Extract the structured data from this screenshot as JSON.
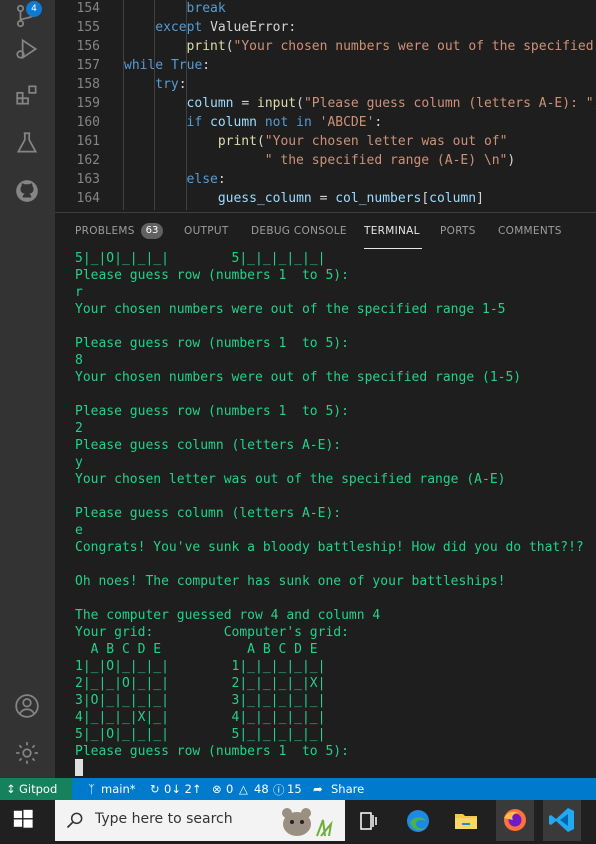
{
  "activity_bar": {
    "source_control_badge": "4"
  },
  "editor": {
    "lines": [
      {
        "num": "154",
        "indent": 12,
        "parts": [
          {
            "t": "break",
            "c": "kw"
          }
        ]
      },
      {
        "num": "155",
        "indent": 8,
        "parts": [
          {
            "t": "except ",
            "c": "kw"
          },
          {
            "t": "ValueError",
            "c": "plain"
          },
          {
            "t": ":",
            "c": "plain"
          }
        ]
      },
      {
        "num": "156",
        "indent": 12,
        "parts": [
          {
            "t": "print",
            "c": "fn"
          },
          {
            "t": "(",
            "c": "plain"
          },
          {
            "t": "\"Your chosen numbers were out of the specified range\")",
            "c": "str"
          }
        ]
      },
      {
        "num": "157",
        "indent": 4,
        "parts": [
          {
            "t": "while ",
            "c": "kw"
          },
          {
            "t": "True",
            "c": "kw"
          },
          {
            "t": ":",
            "c": "plain"
          }
        ]
      },
      {
        "num": "158",
        "indent": 8,
        "parts": [
          {
            "t": "try",
            "c": "kw"
          },
          {
            "t": ":",
            "c": "plain"
          }
        ]
      },
      {
        "num": "159",
        "indent": 12,
        "parts": [
          {
            "t": "column",
            "c": "var"
          },
          {
            "t": " = ",
            "c": "plain"
          },
          {
            "t": "input",
            "c": "fn"
          },
          {
            "t": "(",
            "c": "plain"
          },
          {
            "t": "\"Please guess column (letters A-E): \")",
            "c": "str"
          }
        ]
      },
      {
        "num": "160",
        "indent": 12,
        "parts": [
          {
            "t": "if ",
            "c": "kw"
          },
          {
            "t": "column",
            "c": "var"
          },
          {
            "t": " not in ",
            "c": "kw"
          },
          {
            "t": "'ABCDE'",
            "c": "str"
          },
          {
            "t": ":",
            "c": "plain"
          }
        ]
      },
      {
        "num": "161",
        "indent": 16,
        "parts": [
          {
            "t": "print",
            "c": "fn"
          },
          {
            "t": "(",
            "c": "plain"
          },
          {
            "t": "\"Your chosen letter was out of\"",
            "c": "str"
          }
        ]
      },
      {
        "num": "162",
        "indent": 22,
        "parts": [
          {
            "t": "\" the specified range (A-E) \\n\"",
            "c": "str"
          },
          {
            "t": ")",
            "c": "plain"
          }
        ]
      },
      {
        "num": "163",
        "indent": 12,
        "parts": [
          {
            "t": "else",
            "c": "kw"
          },
          {
            "t": ":",
            "c": "plain"
          }
        ]
      },
      {
        "num": "164",
        "indent": 16,
        "parts": [
          {
            "t": "guess_column",
            "c": "var"
          },
          {
            "t": " = ",
            "c": "plain"
          },
          {
            "t": "col_numbers",
            "c": "var"
          },
          {
            "t": "[",
            "c": "plain"
          },
          {
            "t": "column",
            "c": "var"
          },
          {
            "t": "]",
            "c": "plain"
          }
        ]
      }
    ]
  },
  "panel": {
    "tabs": [
      {
        "label": "PROBLEMS",
        "active": false
      },
      {
        "label": "OUTPUT",
        "active": false
      },
      {
        "label": "DEBUG CONSOLE",
        "active": false
      },
      {
        "label": "TERMINAL",
        "active": true
      },
      {
        "label": "PORTS",
        "active": false
      },
      {
        "label": "COMMENTS",
        "active": false
      }
    ],
    "problems_count": "63"
  },
  "terminal": {
    "lines": [
      "5|_|O|_|_|_|        5|_|_|_|_|_|",
      "Please guess row (numbers 1  to 5):",
      "r",
      "Your chosen numbers were out of the specified range 1-5",
      "",
      "Please guess row (numbers 1  to 5):",
      "8",
      "Your chosen numbers were out of the specified range (1-5)",
      "",
      "Please guess row (numbers 1  to 5):",
      "2",
      "Please guess column (letters A-E):",
      "y",
      "Your chosen letter was out of the specified range (A-E)",
      "",
      "Please guess column (letters A-E):",
      "e",
      "Congrats! You've sunk a bloody battleship! How did you do that?!?",
      "",
      "Oh noes! The computer has sunk one of your battleships!",
      "",
      "The computer guessed row 4 and column 4",
      "Your grid:         Computer's grid:",
      "  A B C D E           A B C D E",
      "1|_|O|_|_|_|        1|_|_|_|_|_|",
      "2|_|_|O|_|_|        2|_|_|_|_|X|",
      "3|O|_|_|_|_|        3|_|_|_|_|_|",
      "4|_|_|_|X|_|        4|_|_|_|_|_|",
      "5|_|O|_|_|_|        5|_|_|_|_|_|",
      "Please guess row (numbers 1  to 5):"
    ]
  },
  "statusbar": {
    "remote": "Gitpod",
    "branch": "main*",
    "sync": "0↓ 2↑",
    "errors": "0",
    "warnings": "48",
    "info": "15",
    "share": "Share"
  },
  "taskbar": {
    "search_placeholder": "Type here to search"
  },
  "colors": {
    "terminal_text": "#23d18b",
    "statusbar": "#007acc",
    "remote": "#16825d"
  }
}
